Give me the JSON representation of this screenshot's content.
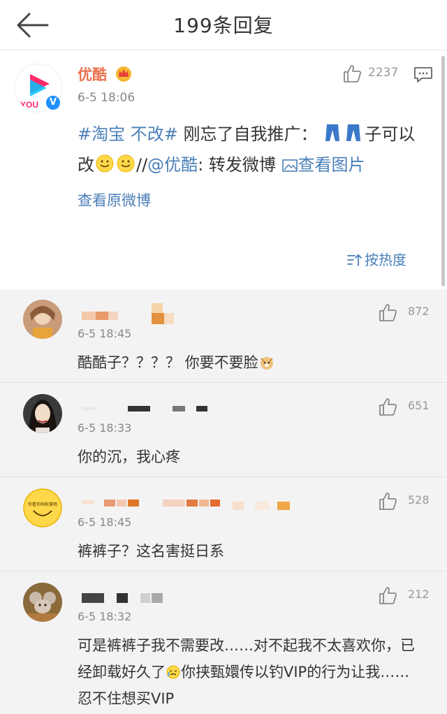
{
  "header": {
    "title": "199条回复",
    "back_icon": "arrow-left-icon"
  },
  "post": {
    "author": "优酷",
    "avatar_text": "YOU",
    "verified_mark": "V",
    "time": "6-5 18:06",
    "likes": "2237",
    "text": {
      "hashtag": "#淘宝 不改#",
      "part1": " 刚忘了自我推广：",
      "part2": "子可以",
      "part3": "改",
      "separator": "//",
      "mention": "@优酷",
      "part4": ": 转发微博 ",
      "view_image": "查看图片"
    },
    "view_original": "查看原微博",
    "sort_label": "按热度"
  },
  "comments": [
    {
      "time": "6-5 18:45",
      "likes": "872",
      "text": "酷酷子？？？？ 你要不要脸"
    },
    {
      "time": "6-5 18:33",
      "likes": "651",
      "text": "你的沉，我心疼"
    },
    {
      "time": "6-5 18:45",
      "likes": "528",
      "text": "裤裤子？这名害挺日系",
      "avatar_text": "你看你妈呢事物"
    },
    {
      "time": "6-5 18:32",
      "likes": "212",
      "text_line1": "可是裤裤子我不需要改……对不起我不太喜欢你，已",
      "text_line2a": "经卸载好久了",
      "text_line2b": "你挟甄嬛传以钓VIP的行为让我……",
      "text_line3": "忍不住想买VIP"
    }
  ],
  "colors": {
    "accent_link": "#4a7fb8",
    "author_orange": "#eb7350",
    "comments_bg": "#f3f3f3"
  }
}
